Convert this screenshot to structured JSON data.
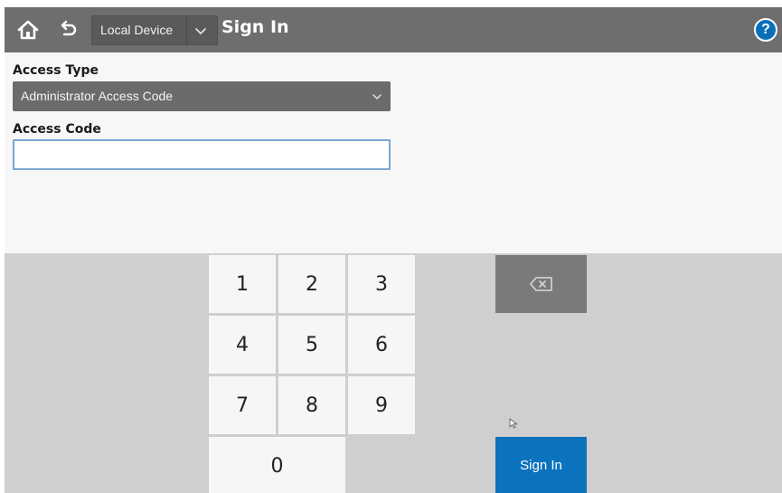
{
  "header": {
    "home_icon": "home-icon",
    "back_icon": "back-arrow-icon",
    "device_select_value": "Local Device",
    "title": "Sign In",
    "help_label": "?"
  },
  "form": {
    "access_type_label": "Access Type",
    "access_type_value": "Administrator Access Code",
    "access_code_label": "Access Code",
    "access_code_value": ""
  },
  "keypad": {
    "keys": [
      "1",
      "2",
      "3",
      "4",
      "5",
      "6",
      "7",
      "8",
      "9",
      "0"
    ],
    "backspace_icon": "backspace-icon",
    "sign_in_label": "Sign In"
  },
  "colors": {
    "topbar": "#6e6e6e",
    "accent_blue": "#0b72bd",
    "keypad_bg": "#cfcfcf"
  }
}
